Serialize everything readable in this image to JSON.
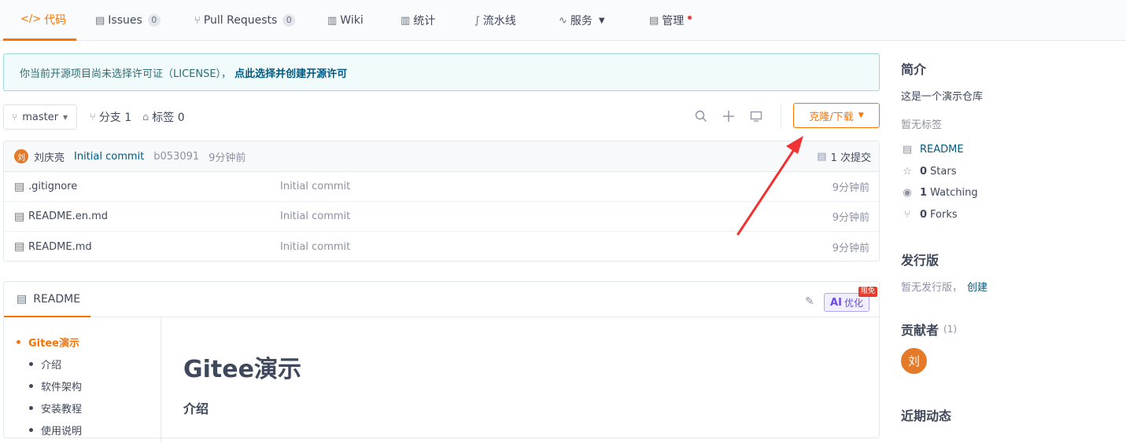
{
  "nav": {
    "tabs": [
      {
        "label": "代码",
        "icon": "code-icon"
      },
      {
        "label": "Issues",
        "badge": "0",
        "icon": "issues-icon"
      },
      {
        "label": "Pull Requests",
        "badge": "0",
        "icon": "pull-request-icon"
      },
      {
        "label": "Wiki",
        "icon": "wiki-icon"
      },
      {
        "label": "统计",
        "icon": "stats-icon"
      },
      {
        "label": "流水线",
        "icon": "pipeline-icon"
      },
      {
        "label": "服务",
        "icon": "service-icon"
      },
      {
        "label": "管理",
        "icon": "manage-icon"
      }
    ],
    "active_color": "#fe7300"
  },
  "license": {
    "text": "你当前开源项目尚未选择许可证（LICENSE），",
    "link": "点此选择并创建开源许可"
  },
  "toolbar": {
    "branch": "master",
    "branches": "分支 1",
    "tags": "标签 0",
    "clone_label": "克隆/下载"
  },
  "commit": {
    "avatar": "刘",
    "author": "刘庆亮",
    "message": "Initial commit",
    "hash": "b053091",
    "time": "9分钟前",
    "count": "1 次提交"
  },
  "files": [
    {
      "name": ".gitignore",
      "message": "Initial commit",
      "time": "9分钟前"
    },
    {
      "name": "README.en.md",
      "message": "Initial commit",
      "time": "9分钟前"
    },
    {
      "name": "README.md",
      "message": "Initial commit",
      "time": "9分钟前"
    }
  ],
  "readme": {
    "tab": "README",
    "ai_label": "AI",
    "ai_text": "优化",
    "promo": "限免",
    "toc": [
      "Gitee演示",
      "介绍",
      "软件架构",
      "安装教程",
      "使用说明"
    ],
    "h1": "Gitee演示",
    "h3": "介绍"
  },
  "sidebar": {
    "intro_title": "简介",
    "intro_text": "这是一个演示仓库",
    "no_tags": "暂无标签",
    "readme": "README",
    "stars_count": "0",
    "stars_label": "Stars",
    "watching_count": "1",
    "watching_label": "Watching",
    "forks_count": "0",
    "forks_label": "Forks",
    "release_title": "发行版",
    "release_text": "暂无发行版，",
    "release_create": "创建",
    "contrib_title": "贡献者",
    "contrib_count": "(1)",
    "contrib_avatar": "刘",
    "activity_title": "近期动态"
  }
}
